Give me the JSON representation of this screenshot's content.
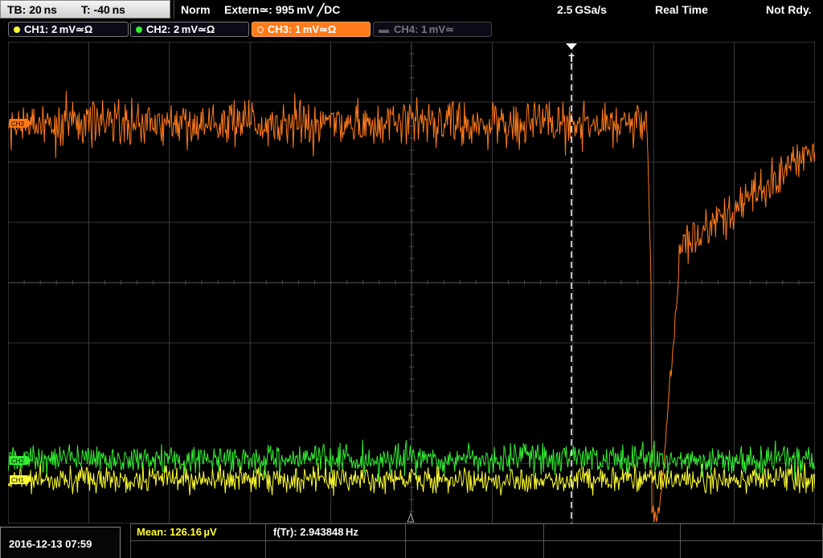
{
  "timebase": {
    "tb_label": "TB: 20 ns",
    "trig_pos": "T: -40 ns"
  },
  "status": {
    "mode": "Norm",
    "trigger": "Extern≃: 995 mV ╱DC",
    "sample_rate": "2.5 GSa/s",
    "acq": "Real Time",
    "state": "Not Rdy."
  },
  "channels": [
    {
      "label": "CH1: 2 mV≃Ω",
      "color": "#ffff33",
      "state": "on"
    },
    {
      "label": "CH2: 2 mV≃Ω",
      "color": "#33ee33",
      "state": "on"
    },
    {
      "label": "CH3: 1 mV≃Ω",
      "color": "#ff7a1a",
      "state": "active"
    },
    {
      "label": "CH4: 1 mV≃",
      "color": "#777777",
      "state": "off"
    }
  ],
  "markers": {
    "trigger_marker": "T",
    "ch3_marker": "CH3",
    "ch2_marker": "CH2",
    "ch1_marker": "CH1"
  },
  "measurements": {
    "mean": "Mean: 126.16 µV",
    "freq": "f(Tr): 2.943848 Hz"
  },
  "datetime": "2016-12-13 07:59",
  "colors": {
    "grid": "#4a4a4a",
    "ch1": "#ffff33",
    "ch2": "#33ee33",
    "ch3": "#ff7a1a",
    "trigger_line": "#ffffff"
  }
}
